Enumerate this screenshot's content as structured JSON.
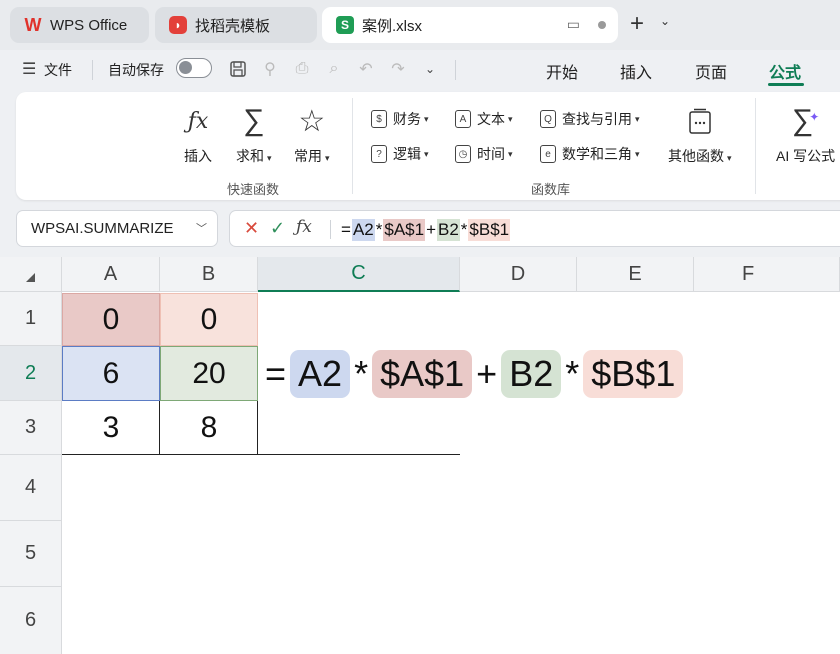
{
  "tabs": [
    {
      "label": "WPS Office",
      "icon": "wps-logo-icon"
    },
    {
      "label": "找稻壳模板",
      "icon": "daoke-icon"
    },
    {
      "label": "案例.xlsx",
      "icon": "spreadsheet-icon",
      "active": true
    }
  ],
  "menu": {
    "file": "文件",
    "autosave": "自动保存",
    "tabs": [
      "开始",
      "插入",
      "页面",
      "公式"
    ],
    "active_tab": "公式"
  },
  "ribbon": {
    "quick": {
      "insert": "插入",
      "sum": "求和",
      "common": "常用",
      "group_label": "快速函数"
    },
    "library": {
      "finance": "财务",
      "text": "文本",
      "lookup": "查找与引用",
      "logic": "逻辑",
      "time": "时间",
      "math": "数学和三角",
      "other": "其他函数",
      "group_label": "函数库"
    },
    "ai_formula": "AI 写公式"
  },
  "namebox": "WPSAI.SUMMARIZE",
  "formula_bar": {
    "tokens": [
      "=",
      "A2",
      "*",
      "$A$1",
      "+",
      "B2",
      "*",
      "$B$1"
    ]
  },
  "sheet": {
    "columns": [
      "A",
      "B",
      "C",
      "D",
      "E",
      "F"
    ],
    "active_column": "C",
    "rows": [
      "1",
      "2",
      "3",
      "4",
      "5",
      "6"
    ],
    "active_row": "2",
    "cells": {
      "A1": "0",
      "B1": "0",
      "A2": "6",
      "B2": "20",
      "A3": "3",
      "B3": "8"
    },
    "inline_formula": [
      "=",
      "A2",
      "*",
      "$A$1",
      "+",
      "B2",
      "*",
      "$B$1"
    ]
  },
  "colors": {
    "accent": "#0f7d55",
    "ref_A2": "#cdd8ef",
    "ref_A1": "#e9c9c7",
    "ref_B2": "#d5e3d3",
    "ref_B1": "#f8ddd7"
  }
}
